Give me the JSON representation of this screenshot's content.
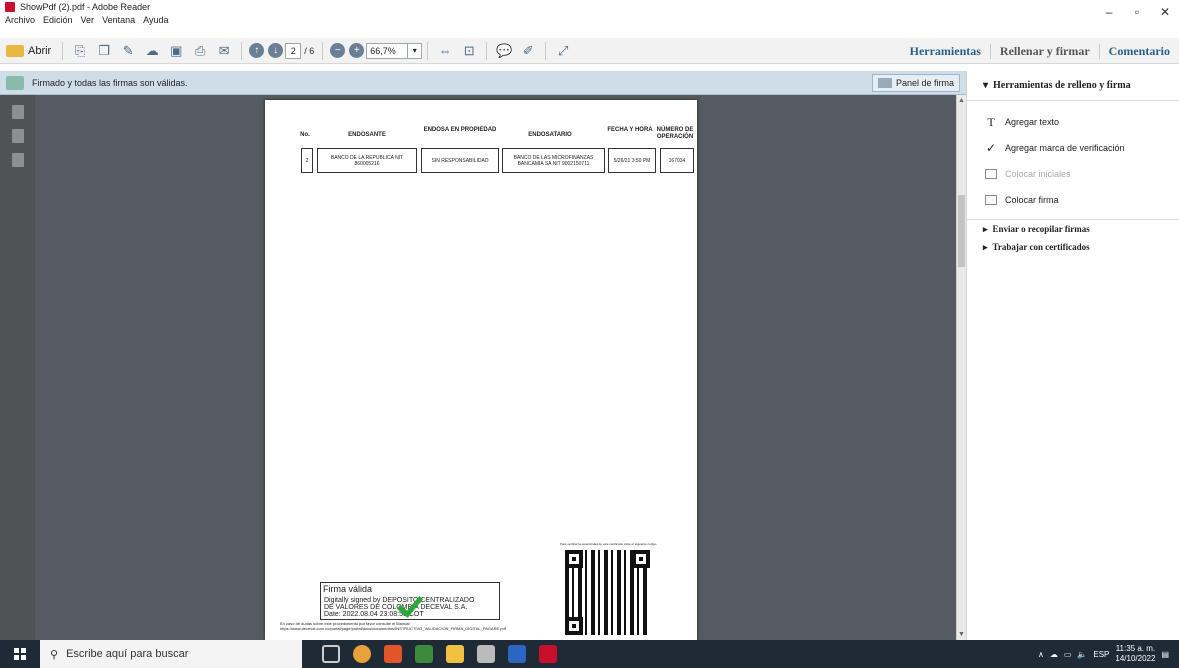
{
  "window": {
    "title": "ShowPdf (2).pdf - Adobe Reader",
    "minimize": "–",
    "maximize": "▫",
    "close": "✕"
  },
  "menu": [
    "Archivo",
    "Edición",
    "Ver",
    "Ventana",
    "Ayuda"
  ],
  "toolbar": {
    "open_label": "Abrir",
    "page_current": "2",
    "page_total": "/ 6",
    "zoom": "66,7%"
  },
  "right_tabs": [
    "Herramientas",
    "Rellenar y firmar",
    "Comentario"
  ],
  "signature_bar": {
    "message": "Firmado y todas las firmas son válidas.",
    "panel_button": "Panel de firma"
  },
  "document": {
    "table_headers": [
      "No.",
      "ENDOSANTE",
      "ENDOSA EN PROPIEDAD",
      "ENDOSATARIO",
      "FECHA Y HORA",
      "NÚMERO DE OPERACIÓN"
    ],
    "row": [
      "2",
      "BANCO DE LA REPUBLICA NIT 860005216",
      "SIN RESPONSABILIDAD",
      "BANCO DE LAS MICROFINANZAS BANCAMIA SA NIT 9002150711",
      "5/26/21 3:50 PM",
      "167034"
    ],
    "qr_note": "Para verificar la autenticidad de este certificado visite el siguiente código",
    "signature": {
      "status": "Firma válida",
      "line1": "Digitally signed by DEPOSITO CENTRALIZADO",
      "line2": "DE VALORES DE COLOMBIA DECEVAL S.A.",
      "line3": "Date: 2022.08.04 23:08:53 COT"
    },
    "footnote": "En caso de dudas sobre este procedimiento por favor consulte el Manual: https://www.deceval.com.co/portal/page/portal/docs/documentos/INSTRUCTIVO_VALIDACION_FIRMA_DIGITAL_PAGARE.pdf"
  },
  "right_panel": {
    "header": "Herramientas de relleno y firma",
    "items": [
      {
        "icon": "T",
        "label": "Agregar texto",
        "enabled": true
      },
      {
        "icon": "✓",
        "label": "Agregar marca de verificación",
        "enabled": true
      },
      {
        "icon": "",
        "label": "Colocar iniciales",
        "enabled": false
      },
      {
        "icon": "",
        "label": "Colocar firma",
        "enabled": true
      }
    ],
    "sections": [
      "Enviar o recopilar firmas",
      "Trabajar con certificados"
    ]
  },
  "taskbar": {
    "search_placeholder": "Escribe aquí para buscar",
    "lang": "ESP",
    "time": "11:35 a. m.",
    "date": "14/10/2022"
  }
}
